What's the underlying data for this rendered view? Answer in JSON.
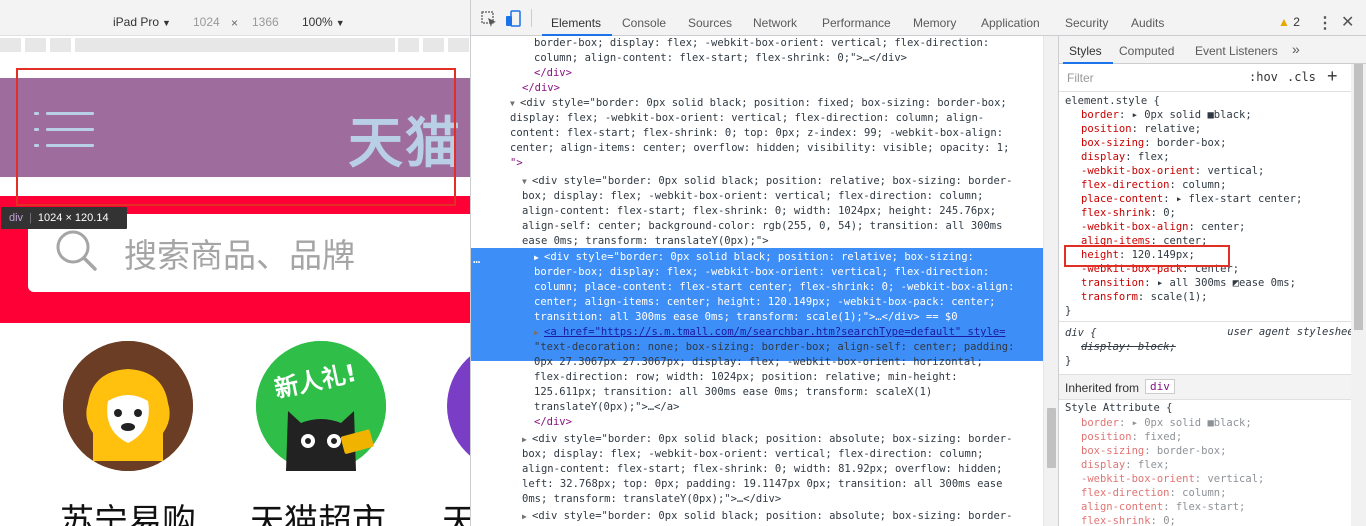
{
  "device_toolbar": {
    "device": "iPad Pro",
    "width": "1024",
    "times": "×",
    "height": "1366",
    "zoom": "100%"
  },
  "page": {
    "logo_text": "天猫",
    "search_placeholder": "搜索商品、品牌",
    "app_labels": [
      "苏宁易购",
      "天猫超市",
      "天"
    ],
    "badge_text": "新人礼!"
  },
  "inspect_tooltip": {
    "tag": "div",
    "size": "1024 × 120.14"
  },
  "devtools": {
    "tabs": [
      "Elements",
      "Console",
      "Sources",
      "Network",
      "Performance",
      "Memory",
      "Application",
      "Security",
      "Audits"
    ],
    "active_tab": "Elements",
    "warning_count": "2",
    "colors": {
      "accent": "#1a73e8",
      "selection": "#3e8ef7",
      "highlight": "#e22f25",
      "tmall_header": "#9e6c9d",
      "tmall_red": "#ff0036"
    }
  },
  "dom_lines": [
    "border-box; display: flex; -webkit-box-orient: vertical; flex-direction:",
    "column; align-content: flex-start; flex-shrink: 0;\">…</div>",
    "</div>",
    "</div>",
    "<div style=\"border: 0px solid black; position: fixed; box-sizing: border-box;",
    "display: flex; -webkit-box-orient: vertical; flex-direction: column; align-",
    "content: flex-start; flex-shrink: 0; top: 0px; z-index: 99; -webkit-box-align:",
    "center; align-items: center; overflow: hidden; visibility: visible; opacity: 1;",
    "\">",
    "<div style=\"border: 0px solid black; position: relative; box-sizing: border-",
    "box; display: flex; -webkit-box-orient: vertical; flex-direction: column;",
    "align-content: flex-start; flex-shrink: 0; width: 1024px; height: 245.76px;",
    "align-self: center; background-color: rgb(255, 0, 54); transition: all 300ms",
    "ease 0ms; transform: translateY(0px);\">",
    "<div style=\"border: 0px solid black; position: relative; box-sizing:",
    "border-box; display: flex; -webkit-box-orient: vertical; flex-direction:",
    "column; place-content: flex-start center; flex-shrink: 0; -webkit-box-align:",
    "center; align-items: center; height: 120.149px; -webkit-box-pack: center;",
    "transition: all 300ms ease 0ms; transform: scale(1);\">…</div> == $0",
    "<a href=\"https://s.m.tmall.com/m/searchbar.htm?searchType=default\" style=",
    "\"text-decoration: none; box-sizing: border-box; align-self: center; padding:",
    "0px 27.3067px 27.3067px; display: flex; -webkit-box-orient: horizontal;",
    "flex-direction: row; width: 1024px; position: relative; min-height:",
    "125.611px; transition: all 300ms ease 0ms; transform: scaleX(1)",
    "translateY(0px);\">…</a>",
    "</div>",
    "<div style=\"border: 0px solid black; position: absolute; box-sizing: border-",
    "box; display: flex; -webkit-box-orient: vertical; flex-direction: column;",
    "align-content: flex-start; flex-shrink: 0; width: 81.92px; overflow: hidden;",
    "left: 32.768px; top: 0px; padding: 19.1147px 0px; transition: all 300ms ease",
    "0ms; transform: translateY(0px);\">…</div>",
    "<div style=\"border: 0px solid black; position: absolute; box-sizing: border-"
  ],
  "styles_pane": {
    "tabs": [
      "Styles",
      "Computed",
      "Event Listeners",
      "»"
    ],
    "filter_placeholder": "Filter",
    "hov": ":hov",
    "cls": ".cls",
    "plus": "+",
    "element_style_header": "element.style {",
    "element_style_props": [
      [
        "border",
        "▸ 0px solid ■black;"
      ],
      [
        "position",
        "relative;"
      ],
      [
        "box-sizing",
        "border-box;"
      ],
      [
        "display",
        "flex;"
      ],
      [
        "-webkit-box-orient",
        "vertical;"
      ],
      [
        "flex-direction",
        "column;"
      ],
      [
        "place-content",
        "▸ flex-start center;"
      ],
      [
        "flex-shrink",
        "0;"
      ],
      [
        "-webkit-box-align",
        "center;"
      ],
      [
        "align-items",
        "center;"
      ],
      [
        "height",
        "120.149px;"
      ],
      [
        "-webkit-box-pack",
        "center;"
      ],
      [
        "transition",
        "▸ all 300ms ◩ease 0ms;"
      ],
      [
        "transform",
        "scale(1);"
      ]
    ],
    "close_brace": "}",
    "ua_selector": "div {",
    "ua_label": "user agent stylesheet",
    "ua_prop": "display: block;",
    "inherited_from": "Inherited from",
    "inherited_tag": "div",
    "style_attribute_header": "Style Attribute {",
    "style_attribute_props": [
      [
        "border",
        "▸ 0px solid ■black;"
      ],
      [
        "position",
        "fixed;"
      ],
      [
        "box-sizing",
        "border-box;"
      ],
      [
        "display",
        "flex;"
      ],
      [
        "-webkit-box-orient",
        "vertical;"
      ],
      [
        "flex-direction",
        "column;"
      ],
      [
        "align-content",
        "flex-start;"
      ],
      [
        "flex-shrink",
        "0;"
      ]
    ]
  }
}
